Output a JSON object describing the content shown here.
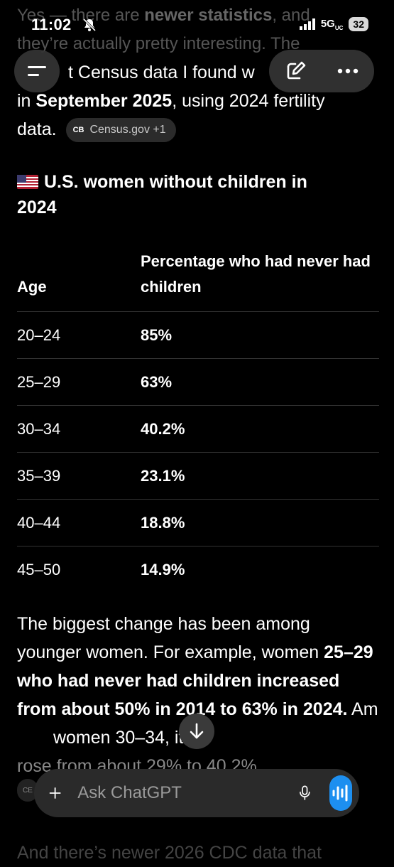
{
  "status": {
    "time": "11:02",
    "network": "5G",
    "network_sub": "UC",
    "battery": "32"
  },
  "faded_top": {
    "line1_prefix": "Yes — there are ",
    "line1_bold": "newer statistics",
    "line1_suffix": ", and",
    "line2": "they’re actually pretty interesting. The"
  },
  "intro": {
    "line1_visible_start": "t Census data I found w",
    "line1_visible_end": "",
    "line2_prefix": "in ",
    "line2_bold": "September 2025",
    "line2_suffix": ", using 2024 fertility",
    "line3": "data.",
    "source_badge": "CB",
    "source_label": "Census.gov +1"
  },
  "heading": {
    "text": "U.S. women without children in 2024"
  },
  "table": {
    "headers": [
      "Age",
      "Percentage who had never had children"
    ],
    "rows": [
      [
        "20–24",
        "85%"
      ],
      [
        "25–29",
        "63%"
      ],
      [
        "30–34",
        "40.2%"
      ],
      [
        "35–39",
        "23.1%"
      ],
      [
        "40–44",
        "18.8%"
      ],
      [
        "45–50",
        "14.9%"
      ]
    ]
  },
  "body": {
    "p1": "The biggest change has been among younger women. For example, women ",
    "p1_bold": "25–29 who had never had children increased from about 50% in 2014 to 63% in 2024.",
    "p2_start": " Am",
    "p2_end": " women 30–34, it",
    "p3": "rose from about 29% to 40.2%",
    "partial_chip": "CE"
  },
  "bottom_faded": "And there’s newer 2026 CDC data that",
  "composer": {
    "placeholder": "Ask ChatGPT"
  },
  "icons": {
    "menu": "menu-icon",
    "compose": "compose-icon",
    "more": "more-icon",
    "scroll": "arrow-down-icon",
    "plus": "plus-icon",
    "mic": "microphone-icon",
    "voice": "voice-waveform-icon"
  },
  "colors": {
    "background": "#000000",
    "voice_button": "#1d8ff0"
  }
}
